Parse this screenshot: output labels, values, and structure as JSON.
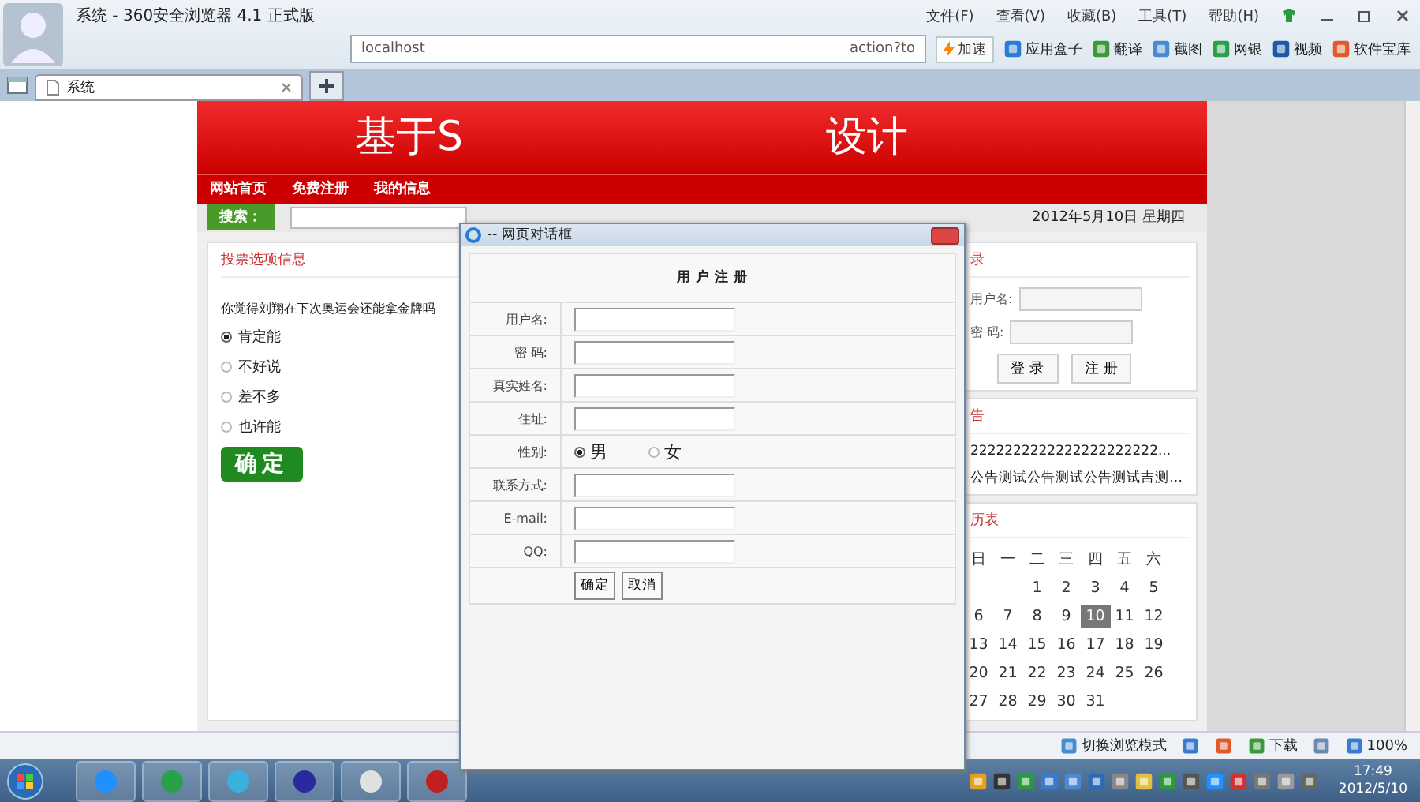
{
  "browser": {
    "title": "系统 - 360安全浏览器 4.1 正式版",
    "menu": [
      "文件(F)",
      "查看(V)",
      "收藏(B)",
      "工具(T)",
      "帮助(H)"
    ],
    "address": {
      "start": "localhost",
      "end": "action?to"
    },
    "speedup": "加速",
    "tools": [
      "应用盒子",
      "翻译",
      "截图",
      "网银",
      "视频",
      "软件宝库"
    ],
    "tabs": [
      {
        "label": "系统",
        "selected": true
      }
    ]
  },
  "page": {
    "header": {
      "title_left": "基于S",
      "title_right": "设计"
    },
    "nav": [
      "网站首页",
      "免费注册",
      "我的信息"
    ],
    "search": {
      "label": "搜索：",
      "date": "2012年5月10日 星期四"
    },
    "vote": {
      "title": "投票选项信息",
      "question": "你觉得刘翔在下次奥运会还能拿金牌吗",
      "options": [
        {
          "label": "肯定能",
          "selected": true
        },
        {
          "label": "不好说",
          "selected": false
        },
        {
          "label": "差不多",
          "selected": false
        },
        {
          "label": "也许能",
          "selected": false
        }
      ],
      "submit": "确定"
    },
    "login": {
      "title": "录",
      "fields": [
        "用户名:",
        "密  码:"
      ],
      "buttons": [
        "登 录",
        "注 册"
      ]
    },
    "notice": {
      "title": "告",
      "items": [
        "2222222222222222222222...",
        "公告测试公告测试公告测试吉测…"
      ]
    },
    "calendar": {
      "title": "历表",
      "weekdays": [
        "日",
        "一",
        "二",
        "三",
        "四",
        "五",
        "六"
      ],
      "weeks": [
        [
          {
            "day": "1",
            "selected": false
          },
          {
            "day": "2",
            "selected": false
          },
          {
            "day": "3",
            "selected": false
          },
          {
            "day": "4",
            "selected": false
          },
          {
            "day": "5",
            "selected": false
          }
        ],
        [
          {
            "day": "6",
            "selected": false
          },
          {
            "day": "7",
            "selected": false
          },
          {
            "day": "8",
            "selected": false
          },
          {
            "day": "9",
            "selected": false
          },
          {
            "day": "10",
            "selected": true
          },
          {
            "day": "11",
            "selected": false
          },
          {
            "day": "12",
            "selected": false
          }
        ],
        [
          {
            "day": "13",
            "selected": false
          },
          {
            "day": "14",
            "selected": false
          },
          {
            "day": "15",
            "selected": false
          },
          {
            "day": "16",
            "selected": false
          },
          {
            "day": "17",
            "selected": false
          },
          {
            "day": "18",
            "selected": false
          },
          {
            "day": "19",
            "selected": false
          }
        ],
        [
          {
            "day": "20",
            "selected": false
          },
          {
            "day": "21",
            "selected": false
          },
          {
            "day": "22",
            "selected": false
          },
          {
            "day": "23",
            "selected": false
          },
          {
            "day": "24",
            "selected": false
          },
          {
            "day": "25",
            "selected": false
          },
          {
            "day": "26",
            "selected": false
          }
        ],
        [
          {
            "day": "27",
            "selected": false
          },
          {
            "day": "28",
            "selected": false
          },
          {
            "day": "29",
            "selected": false
          },
          {
            "day": "30",
            "selected": false
          },
          {
            "day": "31",
            "selected": false
          }
        ]
      ]
    }
  },
  "dialog": {
    "title": "-- 网页对话框",
    "heading": "用 户 注 册",
    "rows": [
      {
        "kind": "text",
        "label": "用户名:"
      },
      {
        "kind": "text",
        "label": "密  码:"
      },
      {
        "kind": "text",
        "label": "真实姓名:"
      },
      {
        "kind": "text",
        "label": "住址:"
      },
      {
        "kind": "radio",
        "label": "性别:",
        "options": [
          {
            "label": "男",
            "selected": true
          },
          {
            "label": "女",
            "selected": false
          }
        ]
      },
      {
        "kind": "text",
        "label": "联系方式:"
      },
      {
        "kind": "text",
        "label": "E-mail:"
      },
      {
        "kind": "text",
        "label": "QQ:"
      }
    ],
    "buttons": [
      "确定",
      "取消"
    ]
  },
  "status_bar": {
    "mode": "切换浏览模式",
    "download": "下载",
    "zoom": "100%"
  },
  "taskbar": {
    "time": "17:49",
    "date": "2012/5/10"
  }
}
